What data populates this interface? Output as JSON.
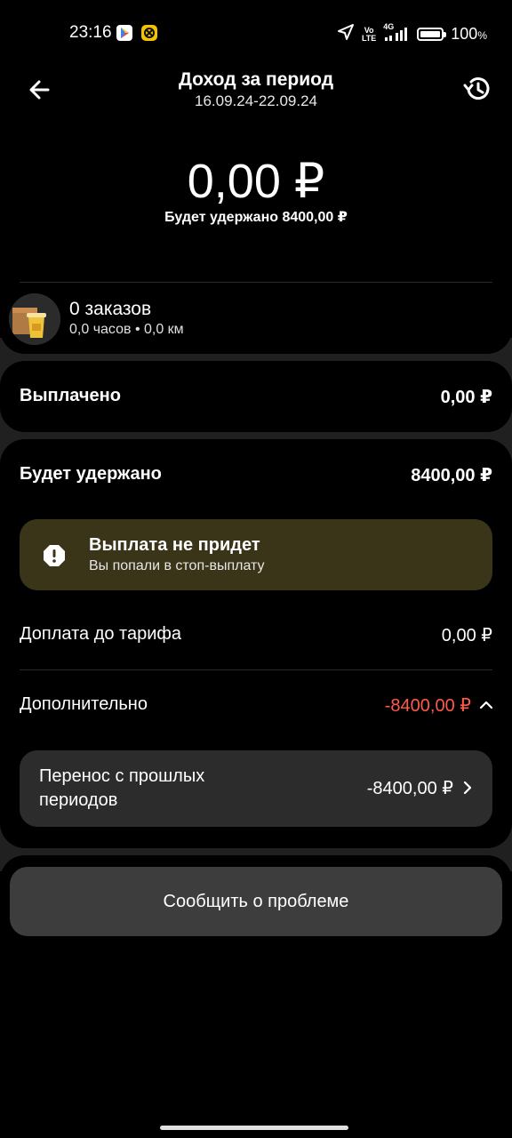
{
  "status_bar": {
    "time": "23:16",
    "network_top": "Vo",
    "network_bottom": "LTE",
    "gen": "4G",
    "battery": "100",
    "battery_unit": "%",
    "battery_level": 1.0
  },
  "header": {
    "title": "Доход за период",
    "period": "16.09.24-22.09.24"
  },
  "summary": {
    "amount": "0,00 ₽",
    "withheld": "Будет удержано 8400,00 ₽"
  },
  "orders": {
    "count": "0 заказов",
    "meta": "0,0 часов • 0,0 км"
  },
  "paid": {
    "label": "Выплачено",
    "value": "0,00 ₽"
  },
  "withheld_section": {
    "label": "Будет удержано",
    "value": "8400,00 ₽",
    "alert_title": "Выплата не придет",
    "alert_sub": "Вы попали в стоп-выплату",
    "surcharge_label": "Доплата до тарифа",
    "surcharge_value": "0,00 ₽",
    "extra_label": "Дополнительно",
    "extra_value": "-8400,00 ₽",
    "transfer_label": "Перенос с прошлых периодов",
    "transfer_value": "-8400,00 ₽"
  },
  "report_button": "Сообщить о проблеме",
  "colors": {
    "background": "#000000",
    "card_gap": "#202020",
    "alert_bg": "#3a3419",
    "negative": "#ff5a4a",
    "button_bg": "#3d3d3d"
  }
}
